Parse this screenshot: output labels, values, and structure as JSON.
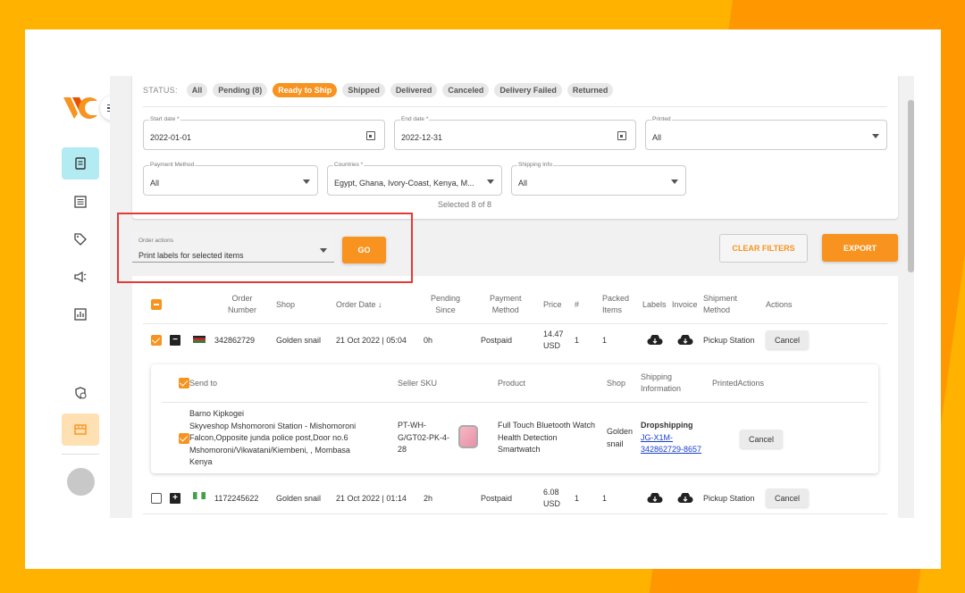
{
  "sidebar": {
    "items": [
      {
        "icon": "orders-icon"
      },
      {
        "icon": "list-icon"
      },
      {
        "icon": "tag-icon"
      },
      {
        "icon": "megaphone-icon"
      },
      {
        "icon": "report-icon"
      },
      {
        "icon": "settings-clock-icon"
      },
      {
        "icon": "store-icon"
      }
    ]
  },
  "filters": {
    "status_label": "STATUS:",
    "statuses": [
      "All",
      "Pending (8)",
      "Ready to Ship",
      "Shipped",
      "Delivered",
      "Canceled",
      "Delivery Failed",
      "Returned"
    ],
    "active_status": "Ready to Ship",
    "start_date": {
      "label": "Start date *",
      "value": "2022-01-01"
    },
    "end_date": {
      "label": "End date *",
      "value": "2022-12-31"
    },
    "printed": {
      "label": "Printed",
      "value": "All"
    },
    "payment_method": {
      "label": "Payment Method",
      "value": "All"
    },
    "countries": {
      "label": "Countries *",
      "value": "Egypt, Ghana, Ivory-Coast, Kenya, M..."
    },
    "shipping_info": {
      "label": "Shipping Info",
      "value": "All"
    },
    "selected_text": "Selected 8 of 8"
  },
  "actions": {
    "order_actions": {
      "label": "Order actions",
      "value": "Print labels for selected items"
    },
    "go_label": "GO",
    "clear_filters_label": "CLEAR FILTERS",
    "export_label": "EXPORT"
  },
  "table": {
    "headers": {
      "order_number": [
        "Order",
        "Number"
      ],
      "shop": "Shop",
      "order_date": "Order Date",
      "pending_since": [
        "Pending",
        "Since"
      ],
      "payment_method": [
        "Payment",
        "Method"
      ],
      "price": "Price",
      "count": "#",
      "packed_items": [
        "Packed",
        "Items"
      ],
      "labels": "Labels",
      "invoice": "Invoice",
      "shipment_method": [
        "Shipment",
        "Method"
      ],
      "actions": "Actions"
    },
    "rows": [
      {
        "order_number": "342862729",
        "shop": "Golden snail",
        "order_date": "21 Oct 2022 | 05:04",
        "pending_since": "0h",
        "payment_method": "Postpaid",
        "price": [
          "14.47",
          "USD"
        ],
        "count": "1",
        "packed_items": "1",
        "shipment_method": "Pickup Station",
        "action_label": "Cancel",
        "flag": "kenya"
      },
      {
        "order_number": "1172245622",
        "shop": "Golden snail",
        "order_date": "21 Oct 2022 | 01:14",
        "pending_since": "2h",
        "payment_method": "Postpaid",
        "price": [
          "6.08",
          "USD"
        ],
        "count": "1",
        "packed_items": "1",
        "shipment_method": "Pickup Station",
        "action_label": "Cancel",
        "flag": "nigeria"
      }
    ]
  },
  "sub_table": {
    "headers": {
      "send_to": "Send to",
      "seller_sku": "Seller SKU",
      "product": "Product",
      "shop": "Shop",
      "shipping_information": [
        "Shipping",
        "Information"
      ],
      "printed_actions": "PrintedActions"
    },
    "item": {
      "send_to": [
        "Barno Kipkogei",
        "Skyveshop Mshomoroni Station - Mishomoroni",
        "Falcon,Opposite junda police post,Door no.6",
        "Mshomoroni/Vikwatani/Kiembeni, , Mombasa",
        "Kenya"
      ],
      "seller_sku": [
        "PT-WH-",
        "G/GT02-PK-4-",
        "28"
      ],
      "product": [
        "Full Touch Bluetooth Watch",
        "Health Detection",
        "Smartwatch"
      ],
      "shop": [
        "Golden",
        "snail"
      ],
      "shipping_type": "Dropshipping",
      "tracking": [
        "JG-X1M-",
        "342862729-8657"
      ],
      "action_label": "Cancel"
    }
  },
  "colors": {
    "accent": "#f7931e",
    "highlight": "#e53935",
    "teal_active": "#b2ebf2"
  }
}
